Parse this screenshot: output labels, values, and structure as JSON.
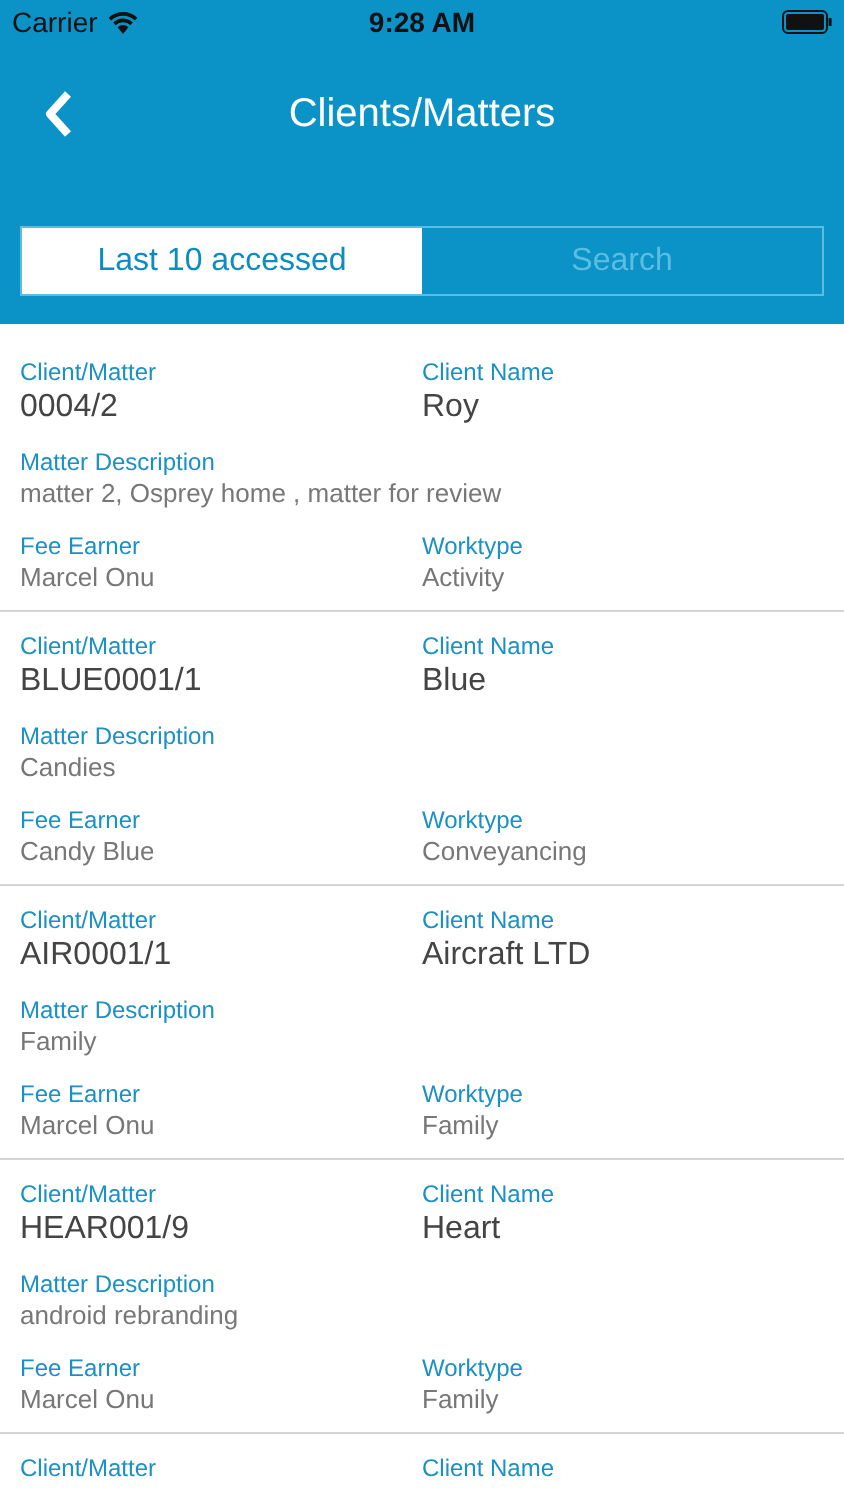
{
  "status_bar": {
    "carrier": "Carrier",
    "time": "9:28 AM"
  },
  "nav": {
    "title": "Clients/Matters"
  },
  "tabs": [
    {
      "label": "Last 10 accessed",
      "selected": true
    },
    {
      "label": "Search",
      "selected": false
    }
  ],
  "matters": [
    {
      "client_matter_label": "Client/Matter",
      "client_matter": "0004/2",
      "client_name_label": "Client Name",
      "client_name": "Roy",
      "description_label": "Matter Description",
      "description": "matter 2, Osprey home , matter for review",
      "fee_earner_label": "Fee Earner",
      "fee_earner": "Marcel Onu",
      "worktype_label": "Worktype",
      "worktype": "Activity"
    },
    {
      "client_matter_label": "Client/Matter",
      "client_matter": "BLUE0001/1",
      "client_name_label": "Client Name",
      "client_name": "Blue",
      "description_label": "Matter Description",
      "description": "Candies",
      "fee_earner_label": "Fee Earner",
      "fee_earner": "Candy Blue",
      "worktype_label": "Worktype",
      "worktype": "Conveyancing"
    },
    {
      "client_matter_label": "Client/Matter",
      "client_matter": "AIR0001/1",
      "client_name_label": "Client Name",
      "client_name": "Aircraft LTD",
      "description_label": "Matter Description",
      "description": "Family",
      "fee_earner_label": "Fee Earner",
      "fee_earner": "Marcel Onu",
      "worktype_label": "Worktype",
      "worktype": "Family"
    },
    {
      "client_matter_label": "Client/Matter",
      "client_matter": "HEAR001/9",
      "client_name_label": "Client Name",
      "client_name": "Heart",
      "description_label": "Matter Description",
      "description": "android rebranding",
      "fee_earner_label": "Fee Earner",
      "fee_earner": "Marcel Onu",
      "worktype_label": "Worktype",
      "worktype": "Family"
    },
    {
      "client_matter_label": "Client/Matter",
      "client_name_label": "Client Name"
    }
  ]
}
